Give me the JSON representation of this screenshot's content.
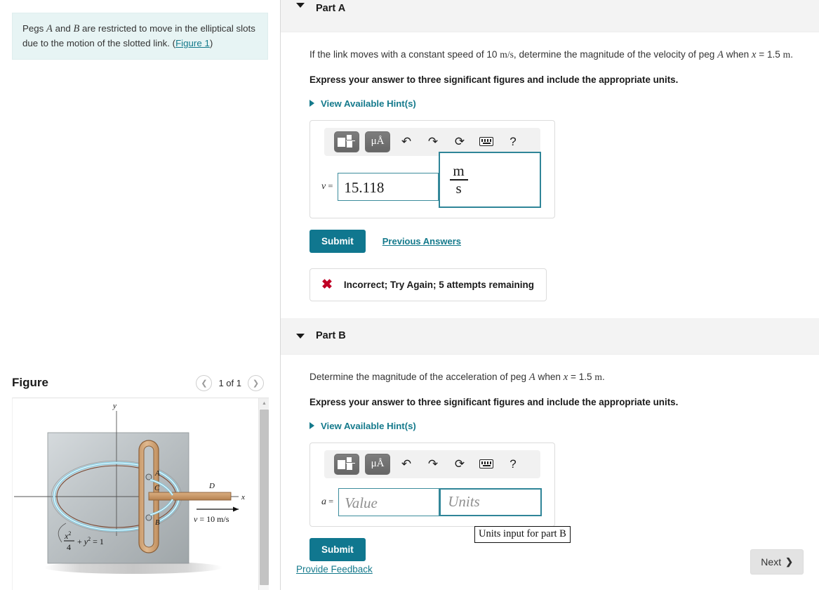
{
  "intro": {
    "text_part1": "Pegs ",
    "peg_a": "A",
    "text_part2": " and ",
    "peg_b": "B",
    "text_part3": " are restricted to move in the elliptical slots due to the motion of the slotted link. (",
    "figure_link": "Figure 1",
    "text_part4": ")"
  },
  "figure_panel": {
    "title": "Figure",
    "page_count": "1 of 1",
    "prev_icon": "chevron-left-icon",
    "next_icon": "chevron-right-icon"
  },
  "figure": {
    "y_axis_label": "y",
    "x_axis_label": "x",
    "peg_a": "A",
    "peg_b": "B",
    "point_c": "C",
    "point_d": "D",
    "velocity_label": "v = 10 m/s",
    "ellipse_eq_num": "x",
    "ellipse_eq": "+ y  = 1",
    "ellipse_denom": "4"
  },
  "part_a": {
    "label": "Part A",
    "question": "If the link moves with a constant speed of 10 m/s, determine the magnitude of the velocity of peg A when x = 1.5 m.",
    "q_lead": "If the link moves with a constant speed of 10 ",
    "q_units1": "m/s",
    "q_mid": ", determine the magnitude of the velocity of peg ",
    "q_var_a": "A",
    "q_when": " when ",
    "q_var_x": "x",
    "q_eq": " = 1.5 ",
    "q_units2": "m",
    "q_end": ".",
    "instruction": "Express your answer to three significant figures and include the appropriate units.",
    "hints_label": "View Available Hint(s)",
    "answer_var": "v",
    "answer_eq": " =",
    "answer_value": "15.118",
    "units_numerator": "m",
    "units_denominator": "s",
    "submit_label": "Submit",
    "previous_answers_label": "Previous Answers",
    "feedback": "Incorrect; Try Again; 5 attempts remaining",
    "feedback_icon": "x-mark-icon"
  },
  "part_b": {
    "label": "Part B",
    "q_lead": "Determine the magnitude of the acceleration of peg ",
    "q_var_a": "A",
    "q_when": " when ",
    "q_var_x": "x",
    "q_eq": " = 1.5 ",
    "q_units": "m",
    "q_end": ".",
    "instruction": "Express your answer to three significant figures and include the appropriate units.",
    "hints_label": "View Available Hint(s)",
    "answer_var": "a",
    "answer_eq": " =",
    "value_placeholder": "Value",
    "units_placeholder": "Units",
    "tooltip": "Units input for part B",
    "submit_label": "Submit"
  },
  "toolbar": {
    "template_icon": "math-template-icon",
    "units_icon": "micro-angstrom-icon",
    "units_label": "μÅ",
    "undo_icon": "undo-icon",
    "redo_icon": "redo-icon",
    "reset_icon": "reset-icon",
    "keyboard_icon": "keyboard-icon",
    "help_icon": "help-icon",
    "help_label": "?"
  },
  "footer": {
    "provide_feedback": "Provide Feedback",
    "next_label": "Next",
    "next_icon": "chevron-right-icon"
  },
  "colors": {
    "accent": "#157a8c",
    "submit": "#10778f",
    "error": "#c00025",
    "intro_bg": "#e7f4f4",
    "part_header_bg": "#f3f3f3"
  }
}
